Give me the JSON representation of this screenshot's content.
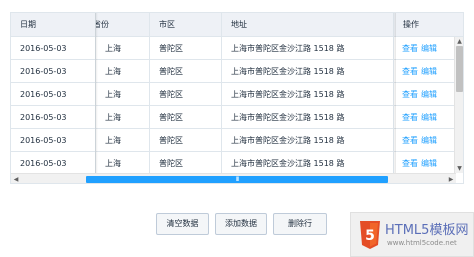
{
  "table": {
    "columns": {
      "date": "日期",
      "province": "省份",
      "district": "市区",
      "address": "地址",
      "actions": "操作"
    },
    "rows": [
      {
        "date": "2016-05-03",
        "province": "上海",
        "district": "普陀区",
        "address": "上海市普陀区金沙江路 1518 路",
        "view": "查看",
        "edit": "编辑"
      },
      {
        "date": "2016-05-03",
        "province": "上海",
        "district": "普陀区",
        "address": "上海市普陀区金沙江路 1518 路",
        "view": "查看",
        "edit": "编辑"
      },
      {
        "date": "2016-05-03",
        "province": "上海",
        "district": "普陀区",
        "address": "上海市普陀区金沙江路 1518 路",
        "view": "查看",
        "edit": "编辑"
      },
      {
        "date": "2016-05-03",
        "province": "上海",
        "district": "普陀区",
        "address": "上海市普陀区金沙江路 1518 路",
        "view": "查看",
        "edit": "编辑"
      },
      {
        "date": "2016-05-03",
        "province": "上海",
        "district": "普陀区",
        "address": "上海市普陀区金沙江路 1518 路",
        "view": "查看",
        "edit": "编辑"
      },
      {
        "date": "2016-05-03",
        "province": "上海",
        "district": "普陀区",
        "address": "上海市普陀区金沙江路 1518 路",
        "view": "查看",
        "edit": "编辑"
      }
    ],
    "scroll_grip": "III"
  },
  "buttons": {
    "clear": "清空数据",
    "add": "添加数据",
    "delete": "删除行"
  },
  "watermark": {
    "title": "HTML5模板网",
    "url": "www.html5code.net",
    "shield_glyph": "5"
  },
  "colors": {
    "accent": "#20a0ff",
    "header_bg": "#eef1f6",
    "border": "#dfe6ec"
  }
}
